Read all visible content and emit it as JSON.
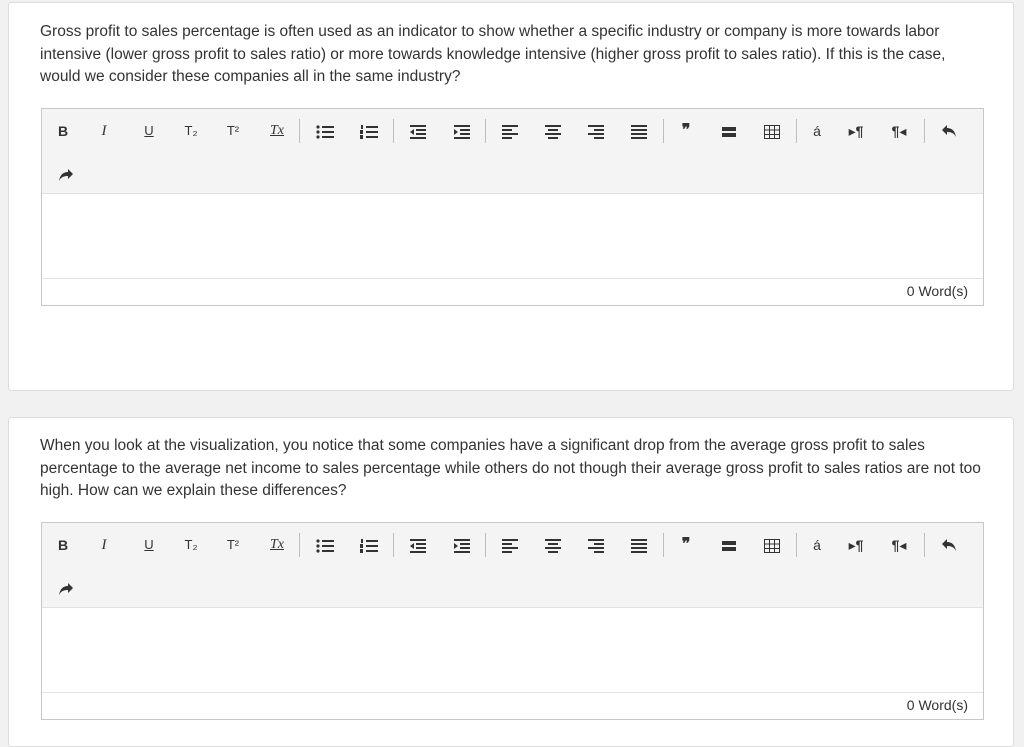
{
  "questions": [
    {
      "text": "Gross profit to sales percentage is often used as an indicator to show whether a specific industry or company is more towards labor intensive (lower gross profit to sales ratio) or more towards knowledge intensive (higher gross profit to sales ratio). If this is the case, would we consider these companies all in the same industry?",
      "word_count": "0 Word(s)"
    },
    {
      "text": "When you look at the visualization, you notice that some companies have a significant drop from the average gross profit to sales percentage to the average net income to sales percentage while others do not though their average gross profit to sales ratios are not too high. How can we explain these differences?",
      "word_count": "0 Word(s)"
    }
  ],
  "toolbar": {
    "bold": "B",
    "italic": "I",
    "underline": "U",
    "subscript": "T₂",
    "superscript": "T²",
    "clear_format": "Tx",
    "special_char": "á"
  }
}
